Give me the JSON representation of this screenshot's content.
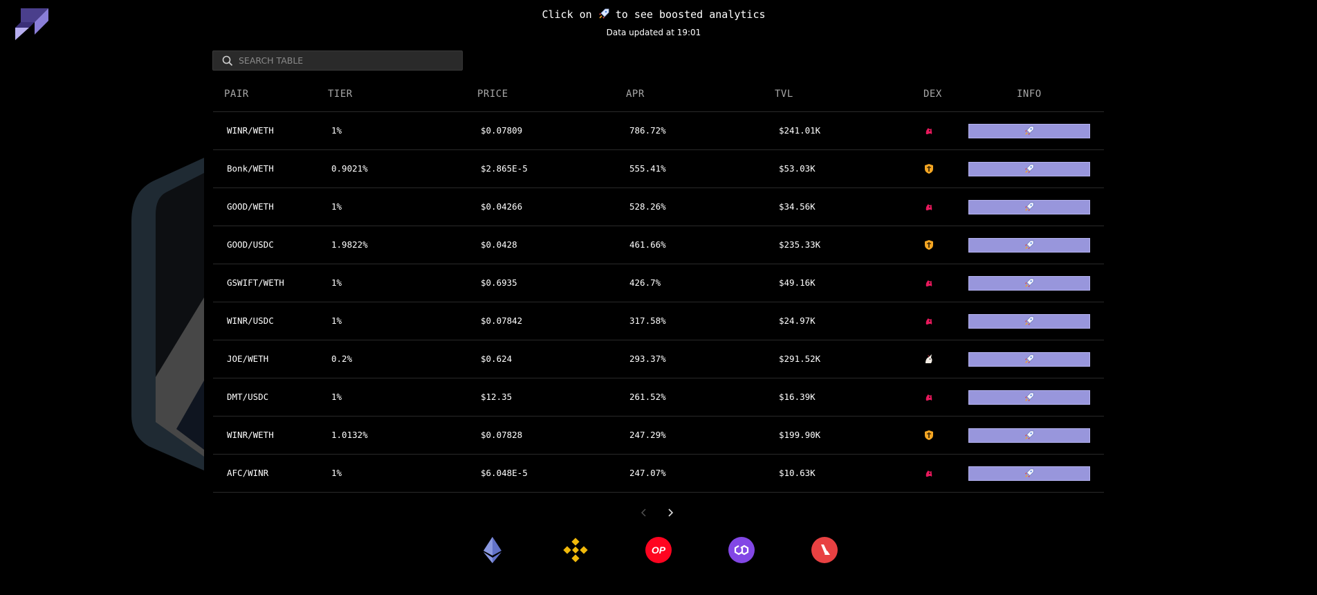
{
  "header": {
    "hint_before": "Click on",
    "hint_after": "to see boosted analytics",
    "updated_text": "Data updated at 19:01",
    "rocket_icon": "rocket-icon"
  },
  "search": {
    "placeholder": "SEARCH TABLE",
    "value": ""
  },
  "table": {
    "columns": [
      "PAIR",
      "TIER",
      "PRICE",
      "APR",
      "TVL",
      "DEX",
      "INFO"
    ],
    "rows": [
      {
        "pair": "WINR/WETH",
        "tier": "1%",
        "price": "$0.07809",
        "apr": "786.72%",
        "tvl": "$241.01K",
        "dex": "uniswap"
      },
      {
        "pair": "Bonk/WETH",
        "tier": "0.9021%",
        "price": "$2.865E-5",
        "apr": "555.41%",
        "tvl": "$53.03K",
        "dex": "shield"
      },
      {
        "pair": "GOOD/WETH",
        "tier": "1%",
        "price": "$0.04266",
        "apr": "528.26%",
        "tvl": "$34.56K",
        "dex": "uniswap"
      },
      {
        "pair": "GOOD/USDC",
        "tier": "1.9822%",
        "price": "$0.0428",
        "apr": "461.66%",
        "tvl": "$235.33K",
        "dex": "shield"
      },
      {
        "pair": "GSWIFT/WETH",
        "tier": "1%",
        "price": "$0.6935",
        "apr": "426.7%",
        "tvl": "$49.16K",
        "dex": "uniswap"
      },
      {
        "pair": "WINR/USDC",
        "tier": "1%",
        "price": "$0.07842",
        "apr": "317.58%",
        "tvl": "$24.97K",
        "dex": "uniswap"
      },
      {
        "pair": "JOE/WETH",
        "tier": "0.2%",
        "price": "$0.624",
        "apr": "293.37%",
        "tvl": "$291.52K",
        "dex": "unicorn"
      },
      {
        "pair": "DMT/USDC",
        "tier": "1%",
        "price": "$12.35",
        "apr": "261.52%",
        "tvl": "$16.39K",
        "dex": "uniswap"
      },
      {
        "pair": "WINR/WETH",
        "tier": "1.0132%",
        "price": "$0.07828",
        "apr": "247.29%",
        "tvl": "$199.90K",
        "dex": "shield"
      },
      {
        "pair": "AFC/WINR",
        "tier": "1%",
        "price": "$6.048E-5",
        "apr": "247.07%",
        "tvl": "$10.63K",
        "dex": "uniswap"
      }
    ]
  },
  "chains": [
    {
      "name": "ethereum-icon",
      "color": "#6272c8"
    },
    {
      "name": "bnb-icon",
      "color": "#f0b90b"
    },
    {
      "name": "optimism-icon",
      "color": "#ff0420",
      "label": "OP"
    },
    {
      "name": "polygon-icon",
      "color": "#8247e5"
    },
    {
      "name": "avalanche-icon",
      "color": "#e84142"
    }
  ],
  "colors": {
    "info_button": "#9896dc",
    "uniswap": "#e8195c",
    "shield": "#f5a623"
  }
}
